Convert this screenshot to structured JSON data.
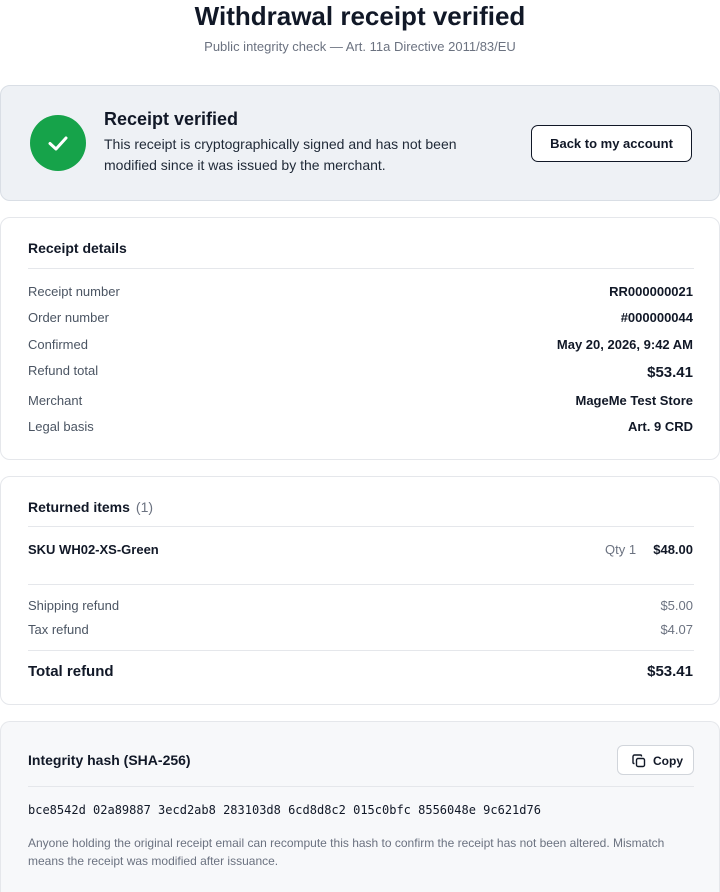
{
  "header": {
    "title": "Withdrawal receipt verified",
    "subtitle": "Public integrity check — Art. 11a Directive 2011/83/EU"
  },
  "verified": {
    "title": "Receipt verified",
    "message": "This receipt is cryptographically signed and has not been modified since it was issued by the merchant.",
    "back_button": "Back to my account",
    "accent_color": "#16a34a"
  },
  "details": {
    "title": "Receipt details",
    "rows": [
      {
        "label": "Receipt number",
        "value": "RR000000021"
      },
      {
        "label": "Order number",
        "value": "#000000044"
      },
      {
        "label": "Confirmed",
        "value": "May 20, 2026, 9:42 AM"
      },
      {
        "label": "Refund total",
        "value": "$53.41"
      },
      {
        "label": "Merchant",
        "value": "MageMe Test Store"
      },
      {
        "label": "Legal basis",
        "value": "Art. 9 CRD"
      }
    ]
  },
  "items": {
    "title": "Returned items",
    "count": "(1)",
    "list": [
      {
        "sku": "SKU WH02-XS-Green",
        "qty": "Qty 1",
        "price": "$48.00"
      }
    ],
    "shipping_label": "Shipping refund",
    "shipping_value": "$5.00",
    "tax_label": "Tax refund",
    "tax_value": "$4.07",
    "total_label": "Total refund",
    "total_value": "$53.41"
  },
  "hash": {
    "title": "Integrity hash (SHA-256)",
    "copy_label": "Copy",
    "value": "bce8542d 02a89887 3ecd2ab8 283103d8 6cd8d8c2 015c0bfc 8556048e 9c621d76",
    "note": "Anyone holding the original receipt email can recompute this hash to confirm the receipt has not been altered. Mismatch means the receipt was modified after issuance."
  }
}
